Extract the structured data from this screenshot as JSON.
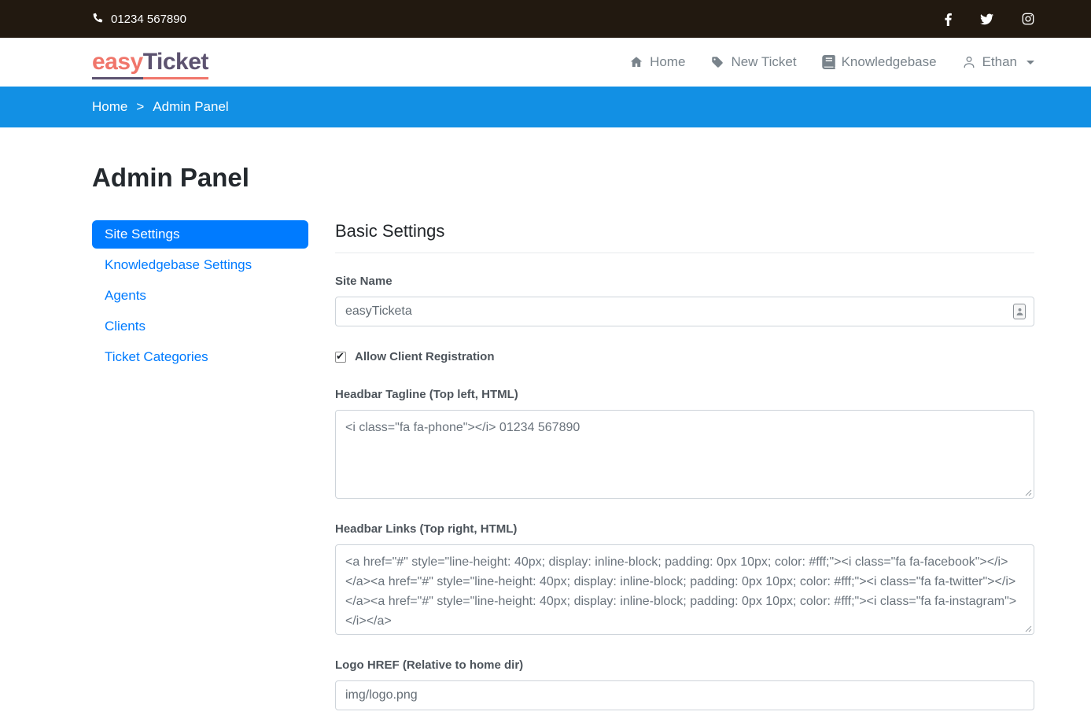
{
  "topbar": {
    "phone_label": "01234 567890",
    "social_icons": [
      "facebook",
      "twitter",
      "instagram"
    ]
  },
  "navbar": {
    "logo_easy": "easy",
    "logo_ticket": "Ticket",
    "items": [
      {
        "label": "Home",
        "icon": "home-icon"
      },
      {
        "label": "New Ticket",
        "icon": "ticket-icon"
      },
      {
        "label": "Knowledgebase",
        "icon": "book-icon"
      },
      {
        "label": "Ethan",
        "icon": "user-icon"
      }
    ]
  },
  "breadcrumb": {
    "home": "Home",
    "separator": ">",
    "current": "Admin Panel"
  },
  "page": {
    "title": "Admin Panel"
  },
  "sidebar": {
    "items": [
      {
        "label": "Site Settings",
        "active": true
      },
      {
        "label": "Knowledgebase Settings",
        "active": false
      },
      {
        "label": "Agents",
        "active": false
      },
      {
        "label": "Clients",
        "active": false
      },
      {
        "label": "Ticket Categories",
        "active": false
      }
    ]
  },
  "settings_form": {
    "section_title": "Basic Settings",
    "site_name": {
      "label": "Site Name",
      "value": "easyTicketa"
    },
    "allow_client_registration": {
      "label": "Allow Client Registration",
      "checked": "checked"
    },
    "headbar_tagline": {
      "label": "Headbar Tagline (Top left, HTML)",
      "value": "<i class=\"fa fa-phone\"></i> 01234 567890"
    },
    "headbar_links": {
      "label": "Headbar Links (Top right, HTML)",
      "value": "<a href=\"#\" style=\"line-height: 40px; display: inline-block; padding: 0px 10px; color: #fff;\"><i class=\"fa fa-facebook\"></i></a><a href=\"#\" style=\"line-height: 40px; display: inline-block; padding: 0px 10px; color: #fff;\"><i class=\"fa fa-twitter\"></i></a><a href=\"#\" style=\"line-height: 40px; display: inline-block; padding: 0px 10px; color: #fff;\"><i class=\"fa fa-instagram\"></i></a>"
    },
    "logo_href": {
      "label": "Logo HREF (Relative to home dir)",
      "value": "img/logo.png"
    }
  },
  "colors": {
    "topbar_bg": "#221910",
    "breadcrumb_bg": "#1290e4",
    "primary": "#007bff",
    "logo_easy": "#f0766b",
    "logo_ticket": "#5d5370"
  }
}
